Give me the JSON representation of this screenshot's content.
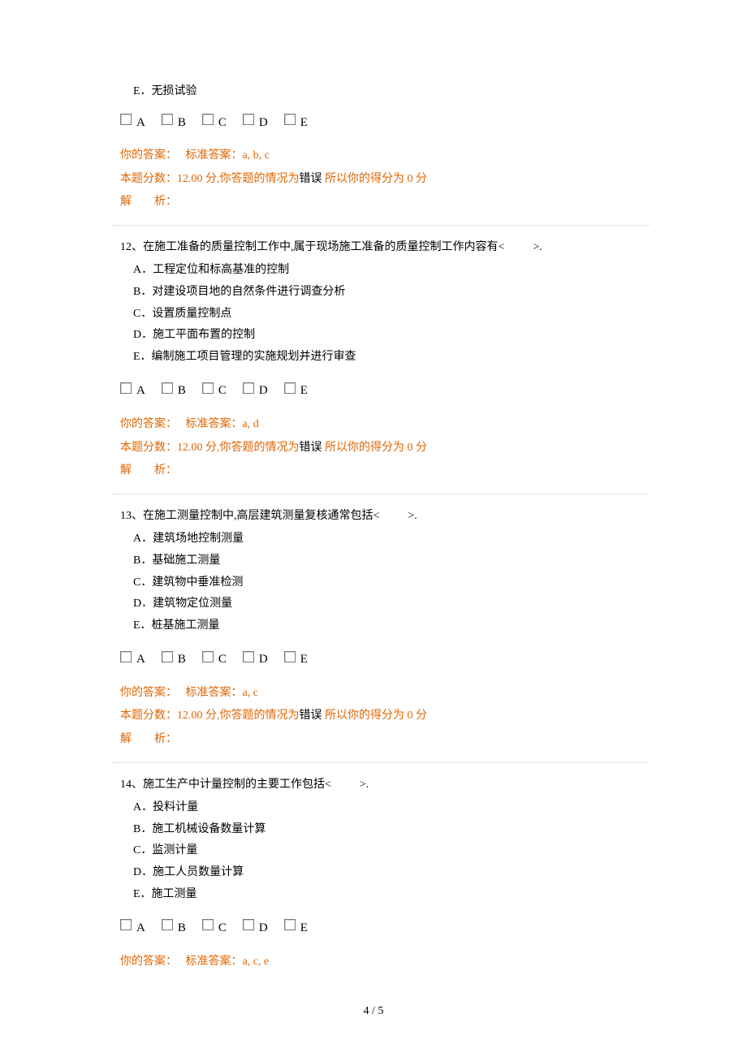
{
  "footer": "4 / 5",
  "cb_labels": [
    "A",
    "B",
    "C",
    "D",
    "E"
  ],
  "q11": {
    "opt_e": "E．无损试验",
    "your_ans_label": "你的答案：",
    "std_ans_label": "标准答案：",
    "std_ans": "a, b, c",
    "score_line_p1": "本题分数：12.00 分,你答题的情况为",
    "score_status": "错误",
    "score_line_p2": " 所以你的得分为 0 分",
    "analysis_label": "解　　析："
  },
  "q12": {
    "stem": "12、在施工准备的质量控制工作中,属于现场施工准备的质量控制工作内容有< 　　 >.",
    "opt_a": "A．工程定位和标高基准的控制",
    "opt_b": "B．对建设项目地的自然条件进行调查分析",
    "opt_c": "C．设置质量控制点",
    "opt_d": "D．施工平面布置的控制",
    "opt_e": "E．编制施工项目管理的实施规划并进行审查",
    "your_ans_label": "你的答案：",
    "std_ans_label": "标准答案：",
    "std_ans": "a, d",
    "score_line_p1": "本题分数：12.00 分,你答题的情况为",
    "score_status": "错误",
    "score_line_p2": " 所以你的得分为 0 分",
    "analysis_label": "解　　析："
  },
  "q13": {
    "stem": "13、在施工测量控制中,高层建筑测量复核通常包括< 　　 >.",
    "opt_a": "A．建筑场地控制测量",
    "opt_b": "B．基础施工测量",
    "opt_c": "C．建筑物中垂准检测",
    "opt_d": "D．建筑物定位测量",
    "opt_e": "E．桩基施工测量",
    "your_ans_label": "你的答案：",
    "std_ans_label": "标准答案：",
    "std_ans": "a, c",
    "score_line_p1": "本题分数：12.00 分,你答题的情况为",
    "score_status": "错误",
    "score_line_p2": " 所以你的得分为 0 分",
    "analysis_label": "解　　析："
  },
  "q14": {
    "stem": "14、施工生产中计量控制的主要工作包括< 　　 >.",
    "opt_a": "A．投料计量",
    "opt_b": "B．施工机械设备数量计算",
    "opt_c": "C．监测计量",
    "opt_d": "D．施工人员数量计算",
    "opt_e": "E．施工测量",
    "your_ans_label": "你的答案：",
    "std_ans_label": "标准答案：",
    "std_ans": "a, c, e"
  }
}
